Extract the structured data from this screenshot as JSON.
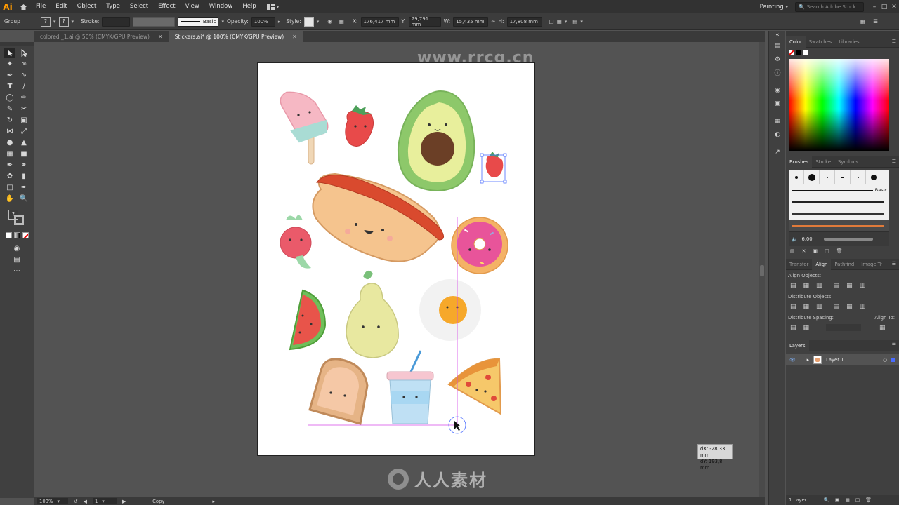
{
  "app": {
    "logo": "Ai",
    "menus": [
      "File",
      "Edit",
      "Object",
      "Type",
      "Select",
      "Effect",
      "View",
      "Window",
      "Help"
    ],
    "workspace": "Painting",
    "search_placeholder": "Search Adobe Stock",
    "window_controls": [
      "–",
      "□",
      "✕"
    ]
  },
  "controlbar": {
    "selection_label": "Group",
    "stroke_label": "Stroke:",
    "brush_label": "Basic",
    "opacity_label": "Opacity:",
    "opacity_value": "100%",
    "style_label": "Style:",
    "x_label": "X:",
    "x_value": "176,417 mm",
    "y_label": "Y:",
    "y_value": "79,791 mm",
    "w_label": "W:",
    "w_value": "15,435 mm",
    "h_label": "H:",
    "h_value": "17,808 mm"
  },
  "tabs": [
    {
      "label": "colored _1.ai @ 50% (CMYK/GPU Preview)",
      "active": false
    },
    {
      "label": "Stickers.ai* @ 100% (CMYK/GPU Preview)",
      "active": true
    }
  ],
  "canvas": {
    "drag_dx": "dX: -28,33 mm",
    "drag_dy": "dY: 193,8 mm",
    "watermark_top": "www.rrcg.cn",
    "watermark_logo": "人人素材"
  },
  "statusbar": {
    "zoom": "100%",
    "artboard": "1",
    "tool": "Copy"
  },
  "panels": {
    "color_tabs": [
      "Color",
      "Swatches",
      "Libraries"
    ],
    "brushes_tabs": [
      "Brushes",
      "Stroke",
      "Symbols"
    ],
    "brush_basic_label": "Basic",
    "brush_size": "6,00",
    "align_tabs": [
      "Transfor",
      "Align",
      "Pathfind",
      "Image Tr"
    ],
    "align_objects": "Align Objects:",
    "distribute_objects": "Distribute Objects:",
    "distribute_spacing": "Distribute Spacing:",
    "align_to": "Align To:",
    "layers_tab": "Layers",
    "layer_name": "Layer 1",
    "layers_count": "1 Layer"
  }
}
